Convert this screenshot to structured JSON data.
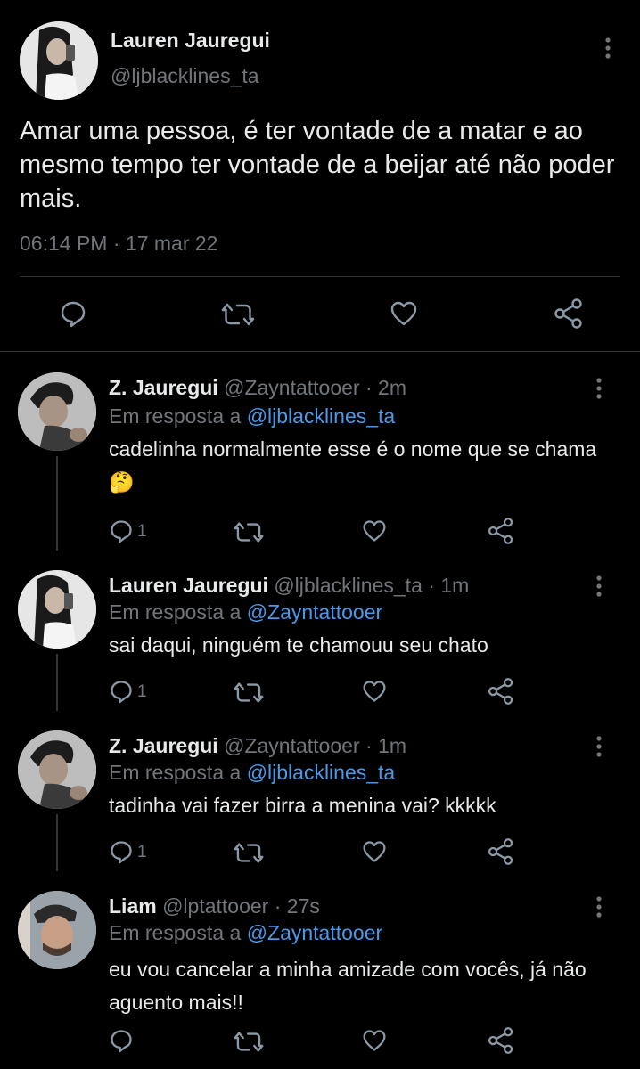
{
  "tweet": {
    "name": "Lauren Jauregui",
    "handle": "@ljblacklines_ta",
    "text": "Amar uma pessoa, é ter vontade de a matar e ao mesmo tempo ter vontade de a beijar até não poder mais.",
    "time": "06:14 PM",
    "sep": "·",
    "date": "17 mar 22",
    "icons": [
      "reply-icon",
      "retweet-icon",
      "like-icon",
      "share-icon",
      "more-icon"
    ]
  },
  "replies": [
    {
      "name": "Z. Jauregui",
      "handle": "@Zayntattooer",
      "sep": "·",
      "age": "2m",
      "in_reply_prefix": "Em resposta a",
      "in_reply_to": "@ljblacklines_ta",
      "text": "cadelinha normalmente esse é o nome que se chama 🤔",
      "reply_count": "1"
    },
    {
      "name": "Lauren Jauregui",
      "handle": "@ljblacklines_ta",
      "sep": "·",
      "age": "1m",
      "in_reply_prefix": "Em resposta a",
      "in_reply_to": "@Zayntattooer",
      "text": "sai daqui, ninguém te chamouu seu chato",
      "reply_count": "1"
    },
    {
      "name": "Z. Jauregui",
      "handle": "@Zayntattooer",
      "sep": "·",
      "age": "1m",
      "in_reply_prefix": "Em resposta a",
      "in_reply_to": "@ljblacklines_ta",
      "text": "tadinha vai fazer birra a menina vai? kkkkk",
      "reply_count": "1"
    },
    {
      "name": "Liam",
      "handle": "@lptattooer",
      "sep": "·",
      "age": "27s",
      "in_reply_prefix": "Em resposta a",
      "in_reply_to": "@Zayntattooer",
      "text": "eu vou cancelar a minha amizade com vocês, já não aguento mais!!",
      "reply_count": ""
    }
  ],
  "colors": {
    "background": "#000000",
    "text": "#e7e9ea",
    "muted": "#71767b",
    "link": "#4a99e9",
    "divider": "#2f3336"
  }
}
